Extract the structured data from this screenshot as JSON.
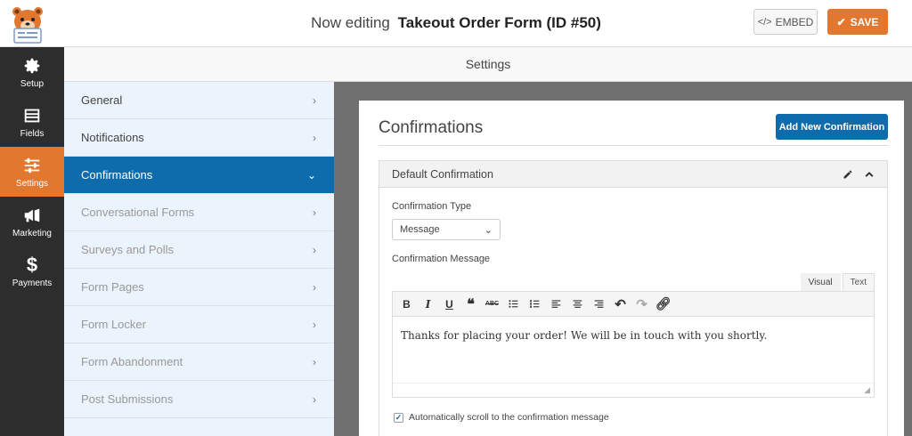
{
  "header": {
    "editing_prefix": "Now editing",
    "form_title": "Takeout Order Form (ID #50)",
    "embed_label": "EMBED",
    "save_label": "SAVE"
  },
  "sidebar": {
    "items": [
      {
        "label": "Setup",
        "icon": "gear-icon"
      },
      {
        "label": "Fields",
        "icon": "fields-icon"
      },
      {
        "label": "Settings",
        "icon": "sliders-icon"
      },
      {
        "label": "Marketing",
        "icon": "megaphone-icon"
      },
      {
        "label": "Payments",
        "icon": "dollar-icon"
      }
    ]
  },
  "subheader": {
    "title": "Settings"
  },
  "settings_menu": {
    "items": [
      {
        "label": "General"
      },
      {
        "label": "Notifications"
      },
      {
        "label": "Confirmations"
      },
      {
        "label": "Conversational Forms"
      },
      {
        "label": "Surveys and Polls"
      },
      {
        "label": "Form Pages"
      },
      {
        "label": "Form Locker"
      },
      {
        "label": "Form Abandonment"
      },
      {
        "label": "Post Submissions"
      }
    ]
  },
  "main": {
    "title": "Confirmations",
    "add_button": "Add New Confirmation",
    "confirmation": {
      "name": "Default Confirmation",
      "type_label": "Confirmation Type",
      "type_value": "Message",
      "message_label": "Confirmation Message",
      "tab_visual": "Visual",
      "tab_text": "Text",
      "message_text": "Thanks for placing your order! We will be in touch with you shortly.",
      "scroll_label": "Automatically scroll to the confirmation message",
      "scroll_checked": true
    }
  },
  "colors": {
    "accent": "#e27730",
    "primary": "#0e6cad",
    "sidebar_bg": "#2d2d2d",
    "panel_bg": "#ebf3fc"
  }
}
